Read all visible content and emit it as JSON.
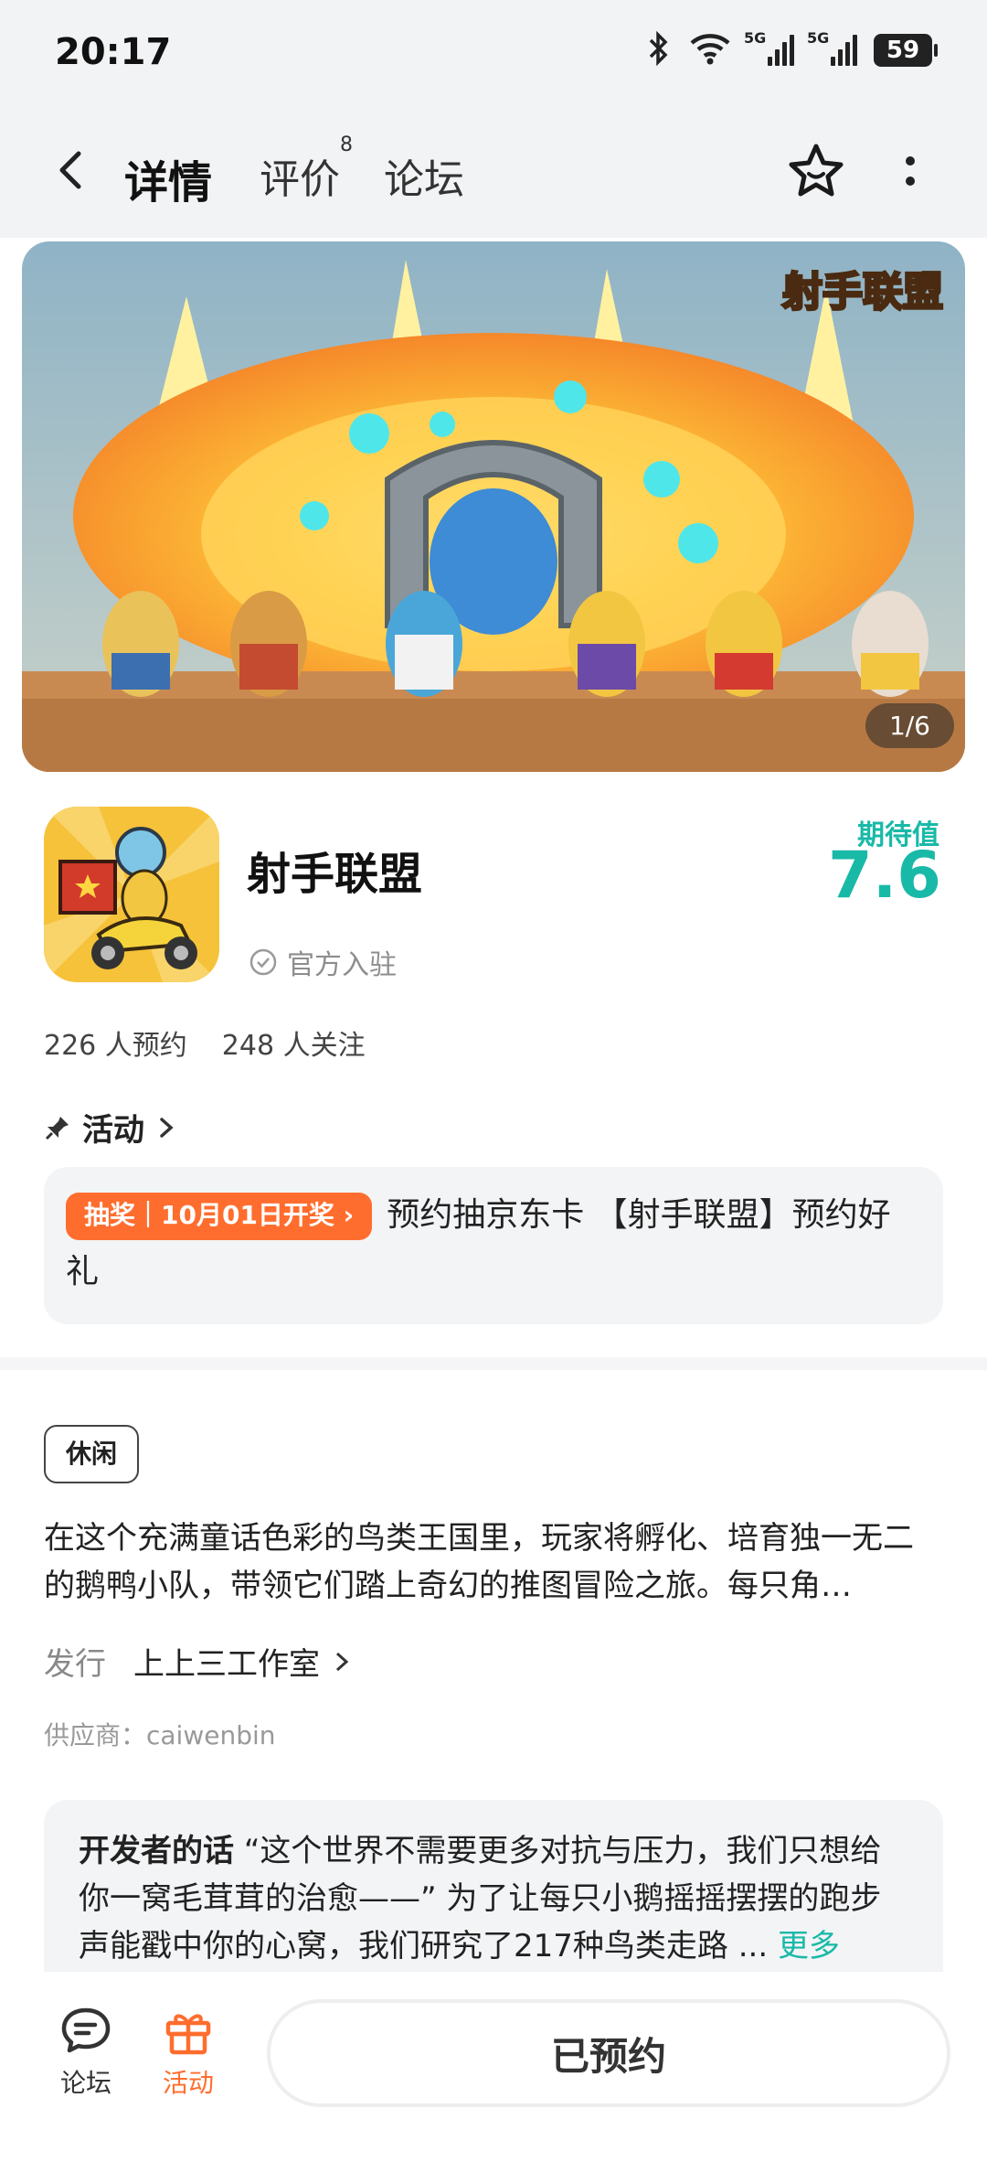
{
  "status_bar": {
    "time": "20:17",
    "battery": "59",
    "network_1": "5G",
    "network_2": "5G"
  },
  "nav": {
    "tabs": [
      {
        "label": "详情",
        "active": true
      },
      {
        "label": "评价",
        "badge": "8"
      },
      {
        "label": "论坛"
      }
    ]
  },
  "banner": {
    "title_art": "射手联盟",
    "counter": "1/6"
  },
  "game": {
    "name": "射手联盟",
    "official_label": "官方入驻",
    "expect_label": "期待值",
    "expect_value": "7.6",
    "reservations": "226 人预约",
    "followers": "248 人关注"
  },
  "activity": {
    "heading": "活动",
    "tag": "抽奖｜10月01日开奖",
    "text": "预约抽京东卡 【射手联盟】预约好礼"
  },
  "details": {
    "genre": "休闲",
    "description": "在这个充满童话色彩的鸟类王国里，玩家将孵化、培育独一无二的鹅鸭小队，带领它们踏上奇幻的推图冒险之旅。每只角…",
    "publisher_label": "发行",
    "publisher": "上上三工作室",
    "supplier": "供应商：caiwenbin"
  },
  "developer": {
    "label": "开发者的话",
    "text": "“这个世界不需要更多对抗与压力，我们只想给你一窝毛茸茸的治愈——” 为了让每只小鹅摇摇摆摆的跑步声能戳中你的心窝，我们研究了217种鸟类走路 ...",
    "more": "更多"
  },
  "bottom": {
    "forum_label": "论坛",
    "activity_label": "活动",
    "reserve_label": "已预约"
  },
  "colors": {
    "accent": "#19b9a8",
    "tag_orange": "#ff6d2e"
  }
}
